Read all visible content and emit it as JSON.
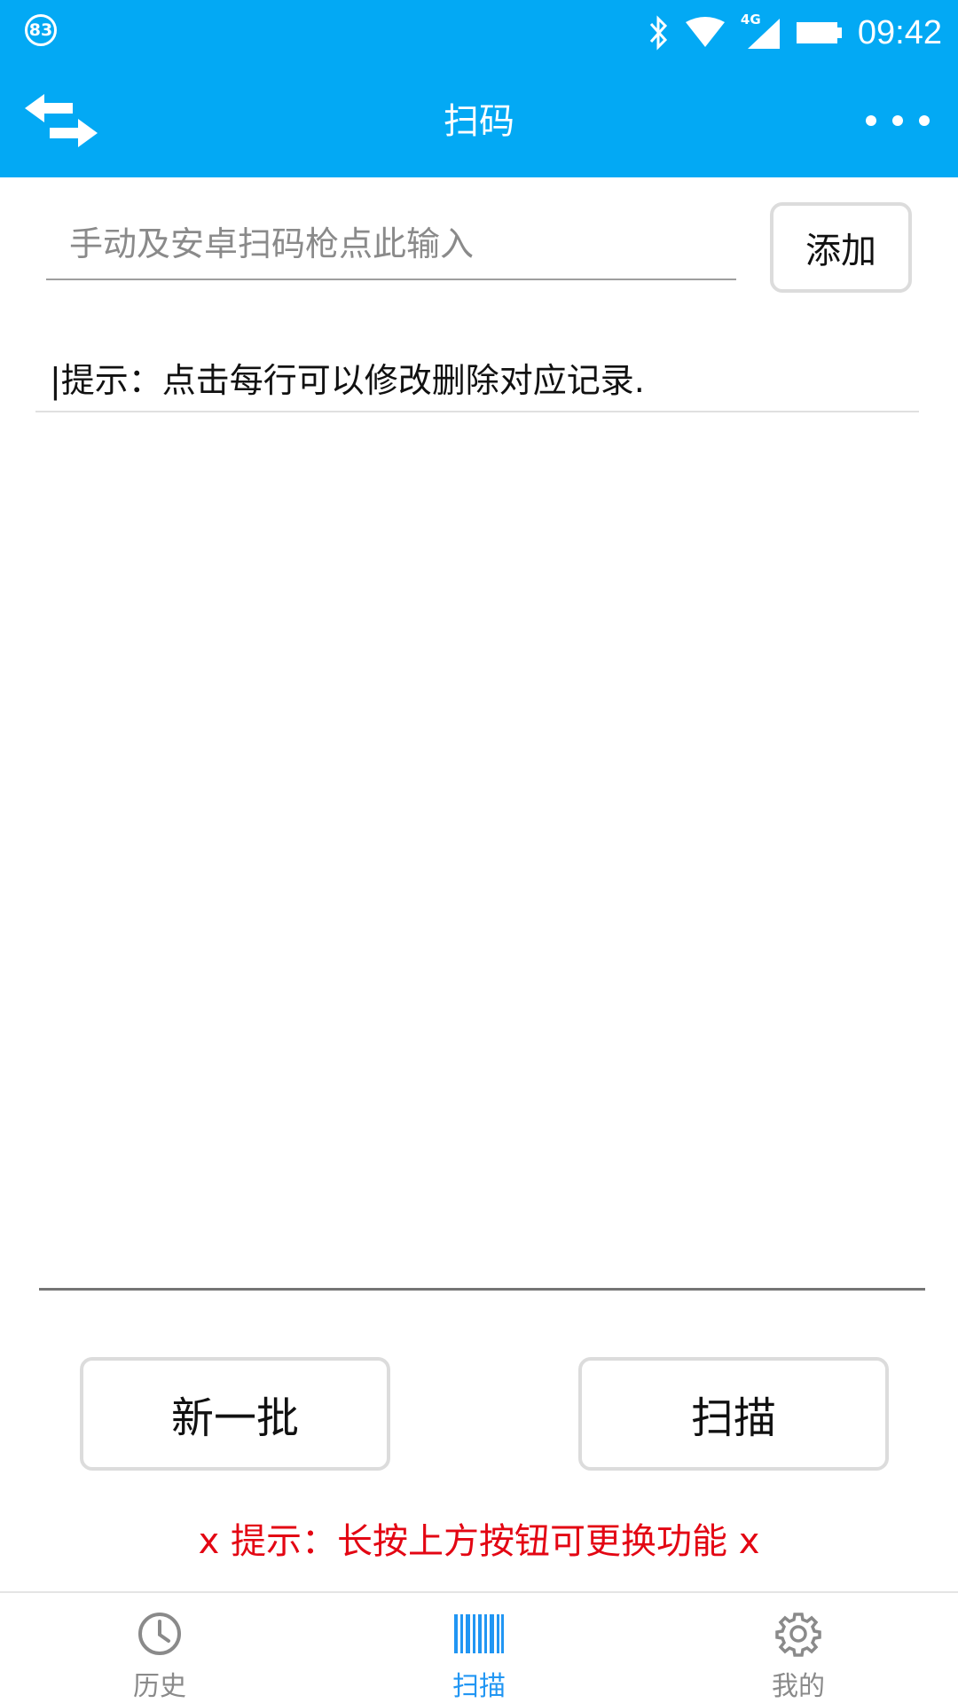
{
  "status_bar": {
    "badge": "83",
    "network": "4G",
    "time": "09:42"
  },
  "app_bar": {
    "title": "扫码"
  },
  "entry": {
    "placeholder": "手动及安卓扫码枪点此输入",
    "add_label": "添加"
  },
  "hint": "|提示：点击每行可以修改删除对应记录.",
  "buttons": {
    "new_batch": "新一批",
    "scan": "扫描"
  },
  "tip": "x  提示：长按上方按钮可更换功能  x",
  "tabs": [
    {
      "label": "历史",
      "icon": "clock-icon",
      "active": false
    },
    {
      "label": "扫描",
      "icon": "barcode-icon",
      "active": true
    },
    {
      "label": "我的",
      "icon": "gear-icon",
      "active": false
    }
  ],
  "colors": {
    "primary": "#03a9f4",
    "tab_active": "#2196f3",
    "tip": "#e30613"
  }
}
